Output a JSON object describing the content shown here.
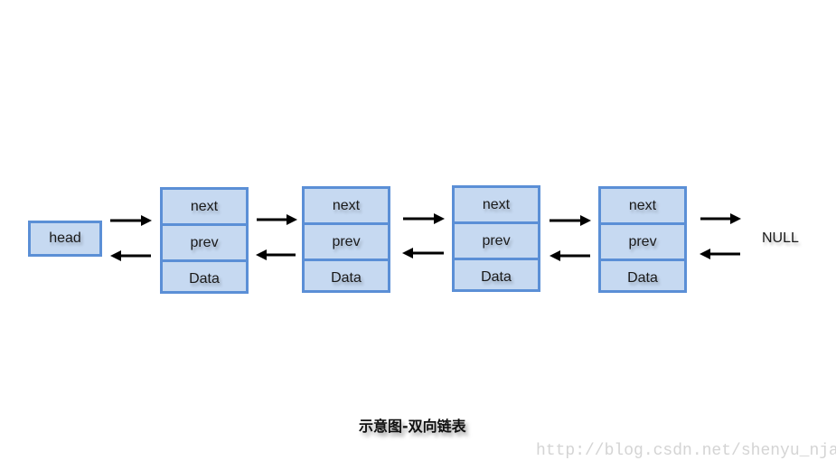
{
  "diagram": {
    "head_label": "head",
    "null_label": "NULL",
    "nodes": [
      {
        "fields": [
          "next",
          "prev",
          "Data"
        ]
      },
      {
        "fields": [
          "next",
          "prev",
          "Data"
        ]
      },
      {
        "fields": [
          "next",
          "prev",
          "Data"
        ]
      },
      {
        "fields": [
          "next",
          "prev",
          "Data"
        ]
      }
    ],
    "caption": "示意图-双向链表",
    "watermark": "http://blog.csdn.net/shenyu_njau"
  },
  "colors": {
    "box_fill": "#c6d9f1",
    "box_border": "#5b8fd6",
    "arrow": "#000000"
  }
}
